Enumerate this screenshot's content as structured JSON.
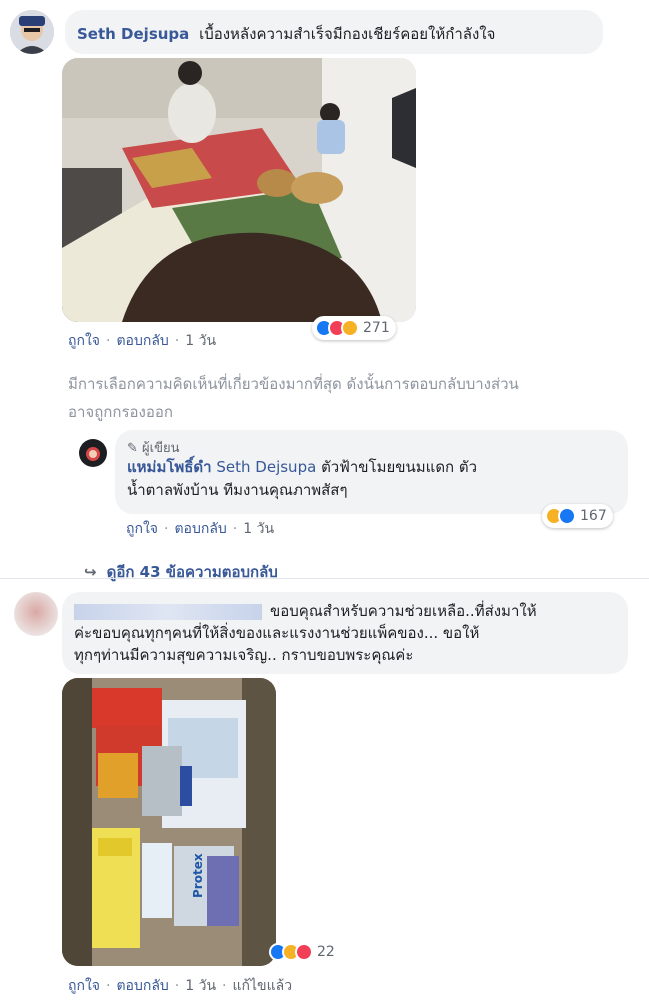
{
  "comment1": {
    "author": "Seth Dejsupa",
    "text": "เบื้องหลังความสำเร็จมีกองเชียร์คอยให้กำลังใจ",
    "like": "ถูกใจ",
    "reply": "ตอบกลับ",
    "time": "1 วัน",
    "reaction_count": "271"
  },
  "filter_notice": {
    "line1": "มีการเลือกความคิดเห็นที่เกี่ยวข้องมากที่สุด ดังนั้นการตอบกลับบางส่วน",
    "line2": "อาจถูกกรองออก"
  },
  "reply1": {
    "author_badge": "ผู้เขียน",
    "author": "แหม่มโพธิ์ดำ",
    "mention": "Seth Dejsupa",
    "text_line1": "ตัวฟ้าขโมยขนมแดก ตัว",
    "text_line2": "น้ำตาลพังบ้าน ทีมงานคุณภาพสัสๆ",
    "like": "ถูกใจ",
    "reply": "ตอบกลับ",
    "time": "1 วัน",
    "reaction_count": "167"
  },
  "more_replies": "ดูอีก 43 ข้อความตอบกลับ",
  "comment2": {
    "text_line1": "ขอบคุณสำหรับความช่วยเหลือ..ที่ส่งมาให้",
    "text_line2": "ค่ะขอบคุณทุกๆคนที่ให้สิ่งของและแรงงานช่วยแพ็คของ... ขอให้",
    "text_line3": "ทุกๆท่านมีความสุขความเจริญ.. กราบขอบพระคุณค่ะ",
    "like": "ถูกใจ",
    "reply": "ตอบกลับ",
    "time": "1 วัน",
    "edited": "แก้ไขแล้ว",
    "reaction_count": "22"
  },
  "product_labels": {
    "brand": "Protex"
  },
  "colors": {
    "link": "#385898",
    "meta": "#606770",
    "bubble": "#f2f3f5",
    "like": "#1877f2",
    "love": "#f33e58",
    "haha": "#f7b125"
  }
}
